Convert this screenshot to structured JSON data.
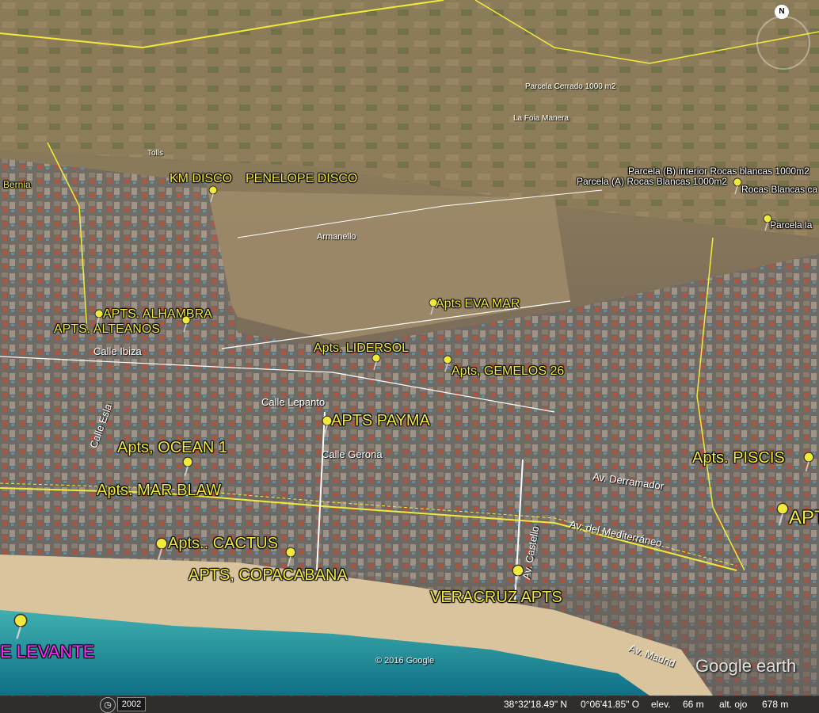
{
  "map": {
    "labels": {
      "bernia": "Bernia",
      "km_disco": "KM DISCO",
      "penelope_disco": "PENELOPE DISCO",
      "parcela_b": "Parcela (B) interior Rocas blancas 1000m2",
      "parcela_a": "Parcela (A) Rocas Blancas 1000m2",
      "rocas_blancas": "Rocas Blancas ca",
      "parcela_la": "Parcela la",
      "armanello": "Armanello",
      "apts_alhambra": "APTS. ALHAMBRA",
      "apts_alteanos": "APTS. ALTEANOS",
      "apts_eva_mar": "Apts EVA MAR",
      "apts_lidersol": "Apts. LIDERSOL",
      "apts_gemelos": "Apts, GEMELOS 26",
      "apts_payma": "APTS PAYMA",
      "apts_ocean": "Apts, OCEAN 1",
      "apts_mar_blaw": "Apts. MAR BLAW",
      "apts_piscis": "Apts. PISCIS",
      "apts_right": "APT",
      "apts_cactus": "Apts.. CACTUS",
      "apts_copacabana": "APTS, COPACABANA",
      "veracruz": "VERACRUZ APTS",
      "levante": "E LEVANTE",
      "tolls": "Tolls",
      "la_foia": "La Foia Manera",
      "parcela_small": "Parcela Cerrado 1000 m2"
    },
    "streets": {
      "calle_ibiza": "Calle Ibiza",
      "calle_lepanto": "Calle Lepanto",
      "calle_gerona": "Calle Gerona",
      "av_derramador": "Av. Derramador",
      "av_mediterraneo": "Av. del Mediterráneo",
      "av_castello": "Av. Castello",
      "av_madrid": "Av. Madrid",
      "calle_esla": "Calle Esla"
    },
    "copyright": "© 2016 Google",
    "logo": "Google earth",
    "north": "N"
  },
  "statusbar": {
    "year": "2002",
    "lat": "38°32'18.49\" N",
    "lon": "0°06'41.85\" O",
    "elev_label": "elev.",
    "elev": "66 m",
    "alt_label": "alt. ojo",
    "alt": "678 m"
  },
  "colors": {
    "label": "#f2ea3a",
    "magenta": "#ff2bff",
    "sea": "#1f8f9a",
    "sand": "#d9c49e"
  }
}
